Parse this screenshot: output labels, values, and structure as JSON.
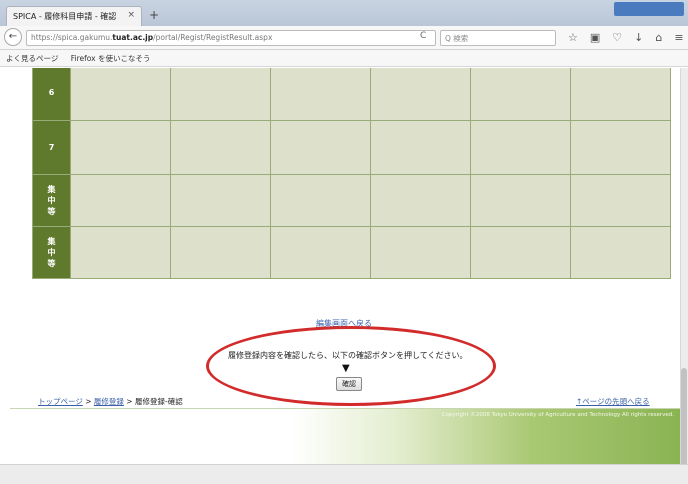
{
  "browser": {
    "tab_title": "SPICA - 履修科目申請 - 確認",
    "tab_close": "×",
    "new_tab": "+",
    "back": "←",
    "url_prefix": "https://spica.gakumu.",
    "url_domain": "tuat.ac.jp",
    "url_path": "/portal/Regist/RegistResult.aspx",
    "reload": "C",
    "search_placeholder": "Q 検索",
    "icons": [
      "star-icon",
      "clipboard-icon",
      "pocket-icon",
      "download-icon",
      "home-icon",
      "menu-icon"
    ],
    "icon_glyphs": [
      "☆",
      "▣",
      "♡",
      "↓",
      "⌂",
      "≡"
    ]
  },
  "bookmarks": [
    {
      "label": "よく見るページ"
    },
    {
      "label": "Firefox を使いこなそう"
    }
  ],
  "timetable": {
    "rows": [
      {
        "label": "6"
      },
      {
        "label": "7"
      },
      {
        "label": "集\n中\n等"
      },
      {
        "label": "集\n中\n等"
      }
    ],
    "day_columns": 6
  },
  "links": {
    "edit": "編集画面へ戻る"
  },
  "confirm": {
    "instruction": "履修登録内容を確認したら、以下の確認ボタンを押してください。",
    "arrow": "▼",
    "button": "確認"
  },
  "breadcrumb": {
    "top": "トップページ",
    "sep1": " > ",
    "regist": "履修登録",
    "sep2": " > ",
    "current": "履修登録-確認"
  },
  "pagetop": "↑ページの先頭へ戻る",
  "footer": {
    "copyright": "Copyright ©2008 Tokyo University of Agriculture and Technology All rights reserved."
  },
  "colors": {
    "period_header": "#5f7a2c",
    "grid_bg": "#dde1cc",
    "highlight_ellipse": "#d22b2b",
    "link": "#3a5fa8"
  }
}
